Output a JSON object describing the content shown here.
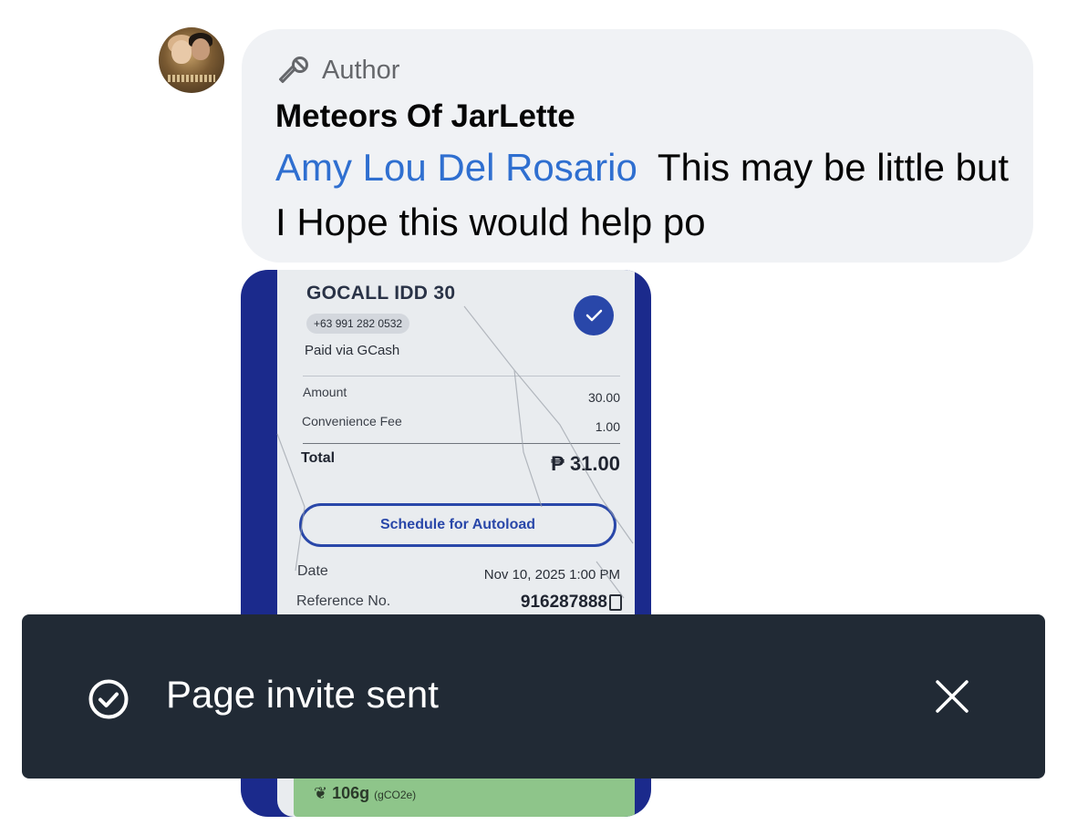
{
  "comment": {
    "author_badge": "Author",
    "author_badge_icon": "microphone-icon",
    "author_name": "Meteors Of JarLette",
    "mention": "Amy Lou Del Rosario",
    "text": "This may be little but I Hope this would help po",
    "mention_color": "#2f6fd0"
  },
  "receipt": {
    "title": "GOCALL IDD 30",
    "number": "+63 991 282 0532",
    "paid_via": "Paid via GCash",
    "amount_label": "Amount",
    "amount_value": "30.00",
    "fee_label": "Convenience Fee",
    "fee_value": "1.00",
    "total_label": "Total",
    "total_value": "₱ 31.00",
    "schedule_button": "Schedule for Autoload",
    "date_label": "Date",
    "date_value": "Nov 10, 2025 1:00 PM",
    "ref_label": "Reference No.",
    "ref_value": "916287888",
    "emission_value": "106g",
    "emission_unit": "(gCO2e)"
  },
  "toast": {
    "message": "Page invite sent",
    "status_icon": "check-circle-icon",
    "close_icon": "close-icon",
    "background": "#212a35"
  }
}
